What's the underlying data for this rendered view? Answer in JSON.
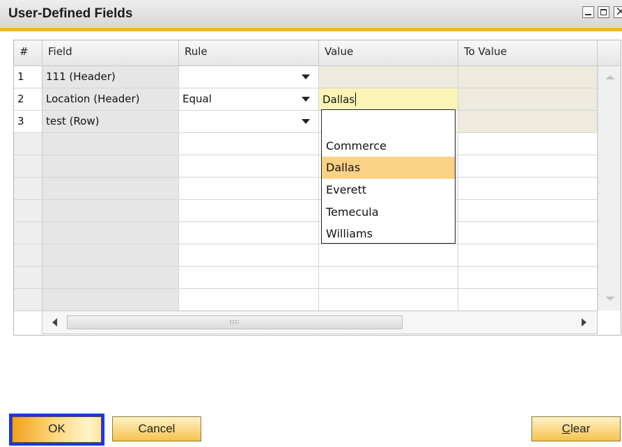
{
  "window": {
    "title": "User-Defined Fields",
    "controls": {
      "minimize": "minimize-icon",
      "maximize": "maximize-icon",
      "close": "close-icon"
    }
  },
  "table": {
    "columns": [
      "#",
      "Field",
      "Rule",
      "Value",
      "To Value"
    ],
    "rows": [
      {
        "num": "1",
        "field": "111 (Header)",
        "rule": "",
        "value": "",
        "to_value": ""
      },
      {
        "num": "2",
        "field": "Location (Header)",
        "rule": "Equal",
        "value": "Dallas",
        "to_value": ""
      },
      {
        "num": "3",
        "field": "test (Row)",
        "rule": "",
        "value": "",
        "to_value": ""
      }
    ]
  },
  "value_dropdown": {
    "options": [
      "",
      "Commerce",
      "Dallas",
      "Everett",
      "Temecula",
      "Williams"
    ],
    "selected": "Dallas"
  },
  "buttons": {
    "ok": "OK",
    "cancel": "Cancel",
    "clear_first": "C",
    "clear_rest": "lear"
  },
  "colors": {
    "accent": "#f3b22f",
    "selection": "#fbd285",
    "focus": "#1a35f0",
    "active_cell": "#fcf4b6"
  }
}
